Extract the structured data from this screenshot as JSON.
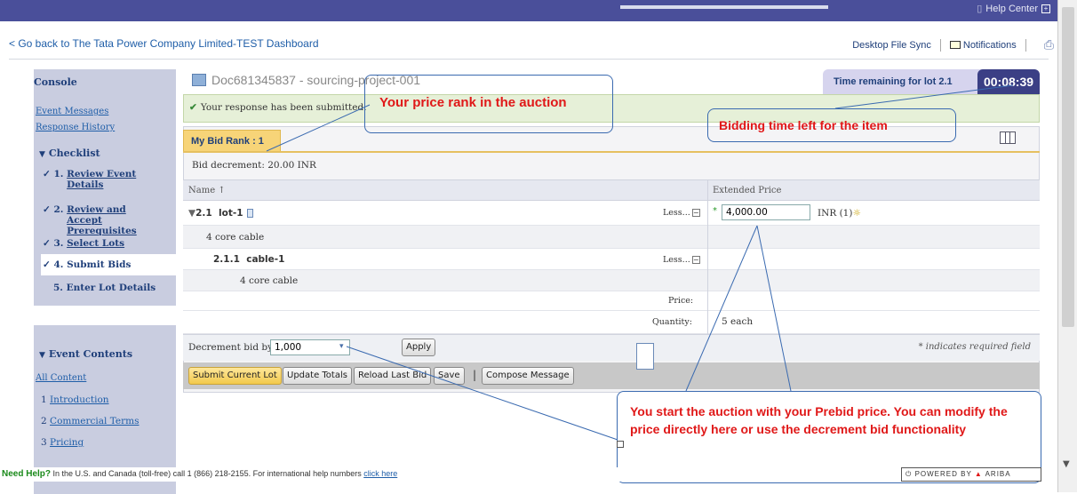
{
  "topbar": {
    "help_center": "Help Center"
  },
  "nav": {
    "back_link": "< Go back to The Tata Power Company Limited-TEST Dashboard",
    "desktop_file_sync": "Desktop File Sync",
    "notifications": "Notifications"
  },
  "sidebar": {
    "console": "Console",
    "event_messages": "Event Messages",
    "response_history": "Response History",
    "checklist_title": "Checklist",
    "checklist": [
      {
        "mark": "✓",
        "num": "1.",
        "label": "Review Event Details",
        "link": true
      },
      {
        "mark": "✓",
        "num": "2.",
        "label": "Review and Accept Prerequisites",
        "link": true
      },
      {
        "mark": "✓",
        "num": "3.",
        "label": "Select Lots",
        "link": true
      },
      {
        "mark": "✓",
        "num": "4.",
        "label": "Submit Bids",
        "link": false
      },
      {
        "mark": "",
        "num": "5.",
        "label": "Enter Lot Details",
        "link": false
      }
    ],
    "event_contents_title": "Event Contents",
    "all_content": "All Content",
    "contents": [
      {
        "num": "1",
        "label": "Introduction"
      },
      {
        "num": "2",
        "label": "Commercial Terms"
      },
      {
        "num": "3",
        "label": "Pricing"
      }
    ]
  },
  "doc": {
    "title": "Doc681345837 - sourcing-project-001"
  },
  "timer": {
    "label": "Time remaining for lot 2.1",
    "value": "00:08:39"
  },
  "success_message": "Your response has been submitted.",
  "bid": {
    "rank_tab": "My Bid Rank : 1",
    "decrement": "Bid decrement:  20.00 INR",
    "col_name": "Name ↑",
    "col_extended": "Extended Price",
    "lot_num": "2.1",
    "lot_name": "lot-1",
    "lot_desc": "4 core cable",
    "less_label": "Less...",
    "price_value": "4,000.00",
    "currency": "INR (1)",
    "item_num": "2.1.1",
    "item_name": "cable-1",
    "item_desc": "4 core cable",
    "price_label": "Price:",
    "quantity_label": "Quantity:",
    "quantity_value": "5 each"
  },
  "decrement_bar": {
    "label": "Decrement bid by",
    "value": "1,000",
    "value_link": "value",
    "apply": "Apply",
    "required_note": "* indicates required field"
  },
  "buttons": {
    "submit": "Submit Current Lot",
    "update": "Update Totals",
    "reload": "Reload Last Bid",
    "save": "Save",
    "compose": "Compose Message"
  },
  "annotations": {
    "rank": "Your price rank in the auction",
    "time": "Bidding time left for the item",
    "prebid": "You start the auction with your Prebid price. You can modify the price directly here or use the decrement bid functionality"
  },
  "footer": {
    "need_help": "Need Help?",
    "text": " In the U.S. and Canada (toll-free) call 1 (866) 218-2155. For international help numbers ",
    "link": "click here",
    "powered": "POWERED BY",
    "brand": "ARIBA"
  },
  "colors": {
    "brand": "#4a4f9a",
    "annotation_text": "#e01818",
    "annotation_border": "#3a6ab0",
    "rank_tab": "#f7d478",
    "timer_bg": "#3b3f85"
  }
}
